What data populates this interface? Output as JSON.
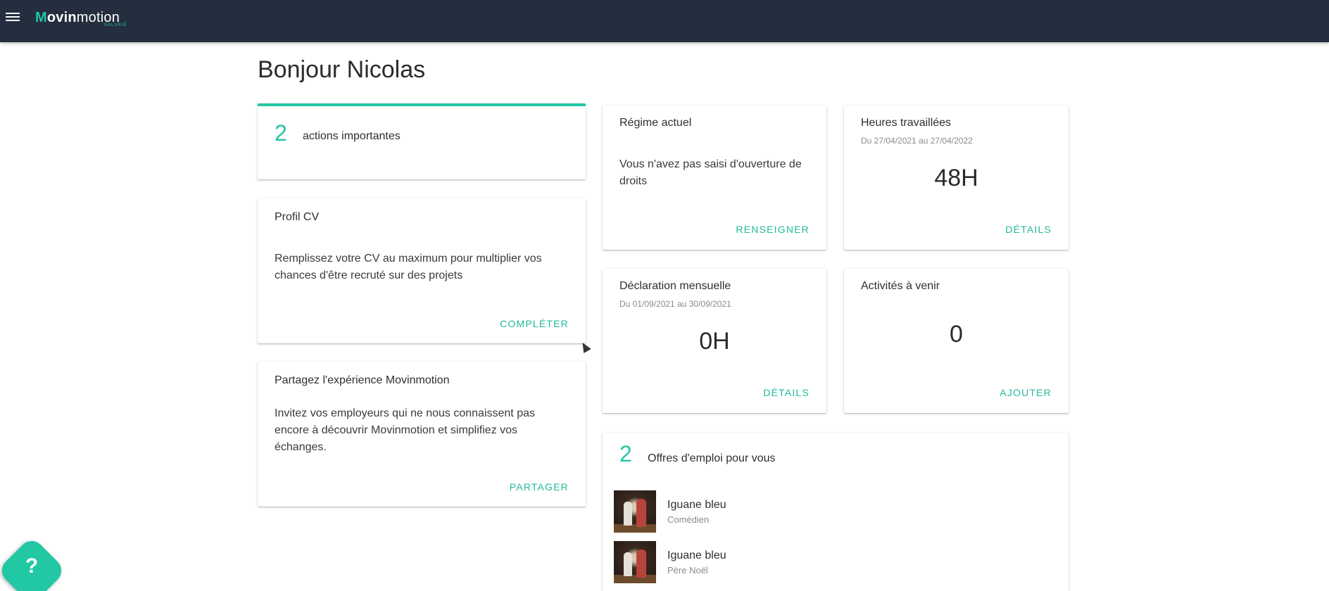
{
  "header": {
    "logo": {
      "prefix": "M",
      "bold": "ovin",
      "rest": "motion",
      "sub": "SALARIÉ"
    }
  },
  "greeting": "Bonjour Nicolas",
  "actions": {
    "count": "2",
    "label": "actions importantes"
  },
  "profil_cv": {
    "title": "Profil CV",
    "body": "Remplissez votre CV au maximum pour multiplier vos chances d'être recruté sur des projets",
    "action": "COMPLÉTER"
  },
  "partage": {
    "title": "Partagez l'expérience Movinmotion",
    "body": "Invitez vos employeurs qui ne nous connaissent pas encore à découvrir Movinmotion et simplifiez vos échanges.",
    "action": "PARTAGER"
  },
  "regime": {
    "title": "Régime actuel",
    "body": "Vous n'avez pas saisi d'ouverture de droits",
    "action": "RENSEIGNER"
  },
  "heures": {
    "title": "Heures travaillées",
    "period": "Du 27/04/2021 au 27/04/2022",
    "value": "48H",
    "action": "DÉTAILS"
  },
  "declaration": {
    "title": "Déclaration mensuelle",
    "period": "Du 01/09/2021 au 30/09/2021",
    "value": "0H",
    "action": "DÉTAILS"
  },
  "activites": {
    "title": "Activités à venir",
    "value": "0",
    "action": "AJOUTER"
  },
  "offres": {
    "count": "2",
    "label": "Offres d'emploi pour vous",
    "jobs": [
      {
        "title": "Iguane bleu",
        "role": "Comédien"
      },
      {
        "title": "Iguane bleu",
        "role": "Père Noël"
      }
    ]
  },
  "help": {
    "label": "?"
  },
  "colors": {
    "accent": "#22c7a3",
    "topbar": "#242e3e"
  }
}
